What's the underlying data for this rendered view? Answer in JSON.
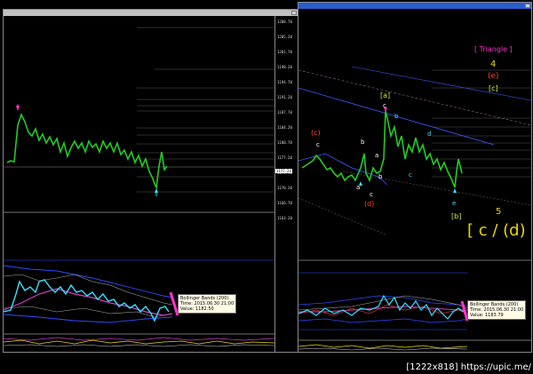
{
  "left_chart": {
    "price_labels": [
      "1208.70",
      "1205.20",
      "1201.70",
      "1198.20",
      "1194.70",
      "1191.20",
      "1187.70",
      "1184.20",
      "1180.70",
      "1177.20",
      "1173.70",
      "1170.20",
      "1166.70",
      "1163.20"
    ],
    "current_price": "1177.24",
    "tooltip": {
      "line1": "Bollinger Bands (200)",
      "line2": "Time: 2015.06.30 21:00",
      "line3": "Value: 1182.50"
    }
  },
  "right_chart": {
    "labels": {
      "triangle": "[ Triangle ]",
      "four": "4",
      "e_paren": "(e)",
      "c_bracket_top": "[c]",
      "a_bracket": "[a]",
      "c_paren": "(c)",
      "d_paren": "(d)",
      "b_bracket": "[b]",
      "five": "5",
      "big": "[ c / (d)",
      "c1": "c",
      "b1": "b",
      "b2": "b",
      "a1": "a",
      "a2": "a",
      "c2": "c",
      "b3": "b",
      "c3": "c",
      "d1": "d",
      "e1": "e",
      "c4": "c"
    },
    "tooltip": {
      "line1": "Bollinger Bands (200)",
      "line2": "Time: 2015.06.30 21:00",
      "line3": "Value: 1183.79"
    }
  },
  "credit": "[1222x818] https://upic.me/",
  "colors": {
    "bg": "#000000",
    "candle": "#22cc22",
    "blue": "#2b4cff",
    "magenta": "#ff33cc",
    "cyan": "#35e0ff",
    "label_red": "#ff4422",
    "label_yellow": "#e8d800"
  }
}
